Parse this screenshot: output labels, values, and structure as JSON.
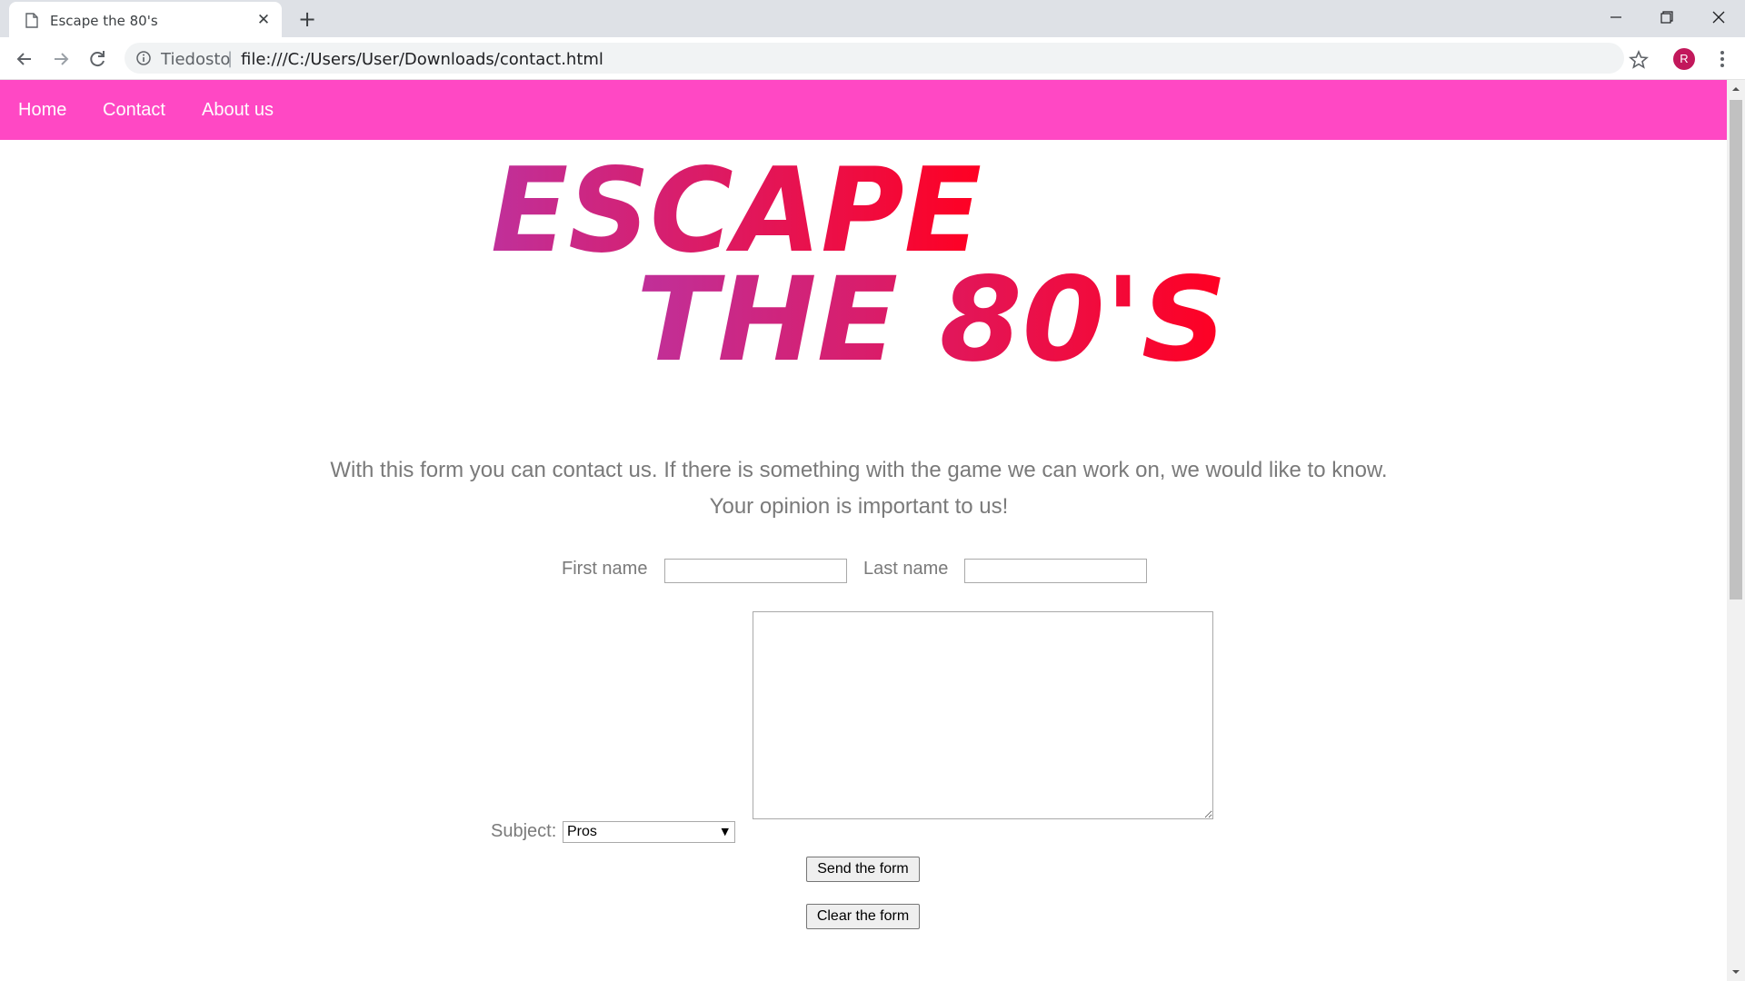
{
  "browser": {
    "tab_title": "Escape the 80's",
    "tab_close": "✕",
    "new_tab": "+",
    "url_origin": "Tiedosto",
    "url_separator": "|",
    "url_path": "file:///C:/Users/User/Downloads/contact.html",
    "avatar_letter": "R"
  },
  "site": {
    "nav": {
      "home": "Home",
      "contact": "Contact",
      "about": "About us"
    },
    "logo": {
      "line1": "ESCAPE",
      "line2": "THE 80'S",
      "gradient_start": "#c0309a",
      "gradient_end": "#ff0022"
    },
    "nav_color": "#ff48c4",
    "intro": "With this form you can contact us. If there is something with the game we can work on, we would like to know. Your opinion is important to us!",
    "form": {
      "first_name_label": "First name",
      "first_name_value": "",
      "last_name_label": "Last name",
      "last_name_value": "",
      "message_value": "",
      "subject_label": "Subject:",
      "subject_selected": "Pros",
      "subject_arrow": "▼",
      "send_label": "Send the form",
      "clear_label": "Clear the form"
    }
  }
}
